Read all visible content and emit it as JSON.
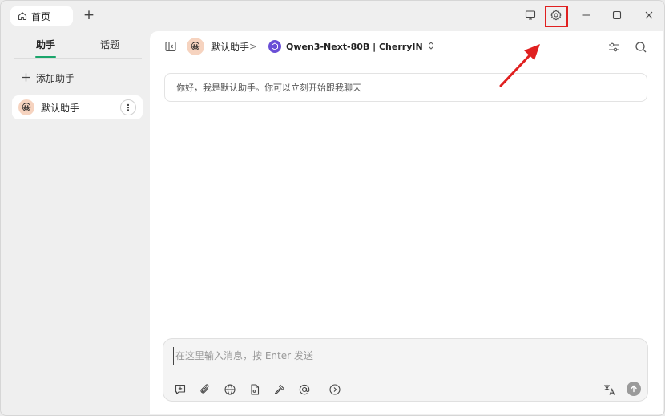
{
  "titlebar": {
    "tab_label": "首页",
    "new_tab_symbol": "+",
    "icons": [
      "monitor-icon",
      "gear-icon",
      "minimize-icon",
      "maximize-icon",
      "close-icon"
    ]
  },
  "sidebar": {
    "tabs": [
      {
        "label": "助手",
        "active": true
      },
      {
        "label": "话题",
        "active": false
      }
    ],
    "add_assistant_label": "添加助手",
    "assistants": [
      {
        "name": "默认助手",
        "avatar_emoji": "😀"
      }
    ]
  },
  "main": {
    "assistant_name": "默认助手",
    "assistant_emoji": "😀",
    "breadcrumb_separator": ">",
    "model_name": "Qwen3-Next-80B | CherryIN",
    "greeting": "你好，我是默认助手。你可以立刻开始跟我聊天",
    "input": {
      "value": "",
      "placeholder": "在这里输入消息，按 Enter 发送"
    }
  },
  "colors": {
    "accent_green": "#1aa56b",
    "highlight_red": "#e02020",
    "model_icon_purple": "#6a4fd6"
  }
}
